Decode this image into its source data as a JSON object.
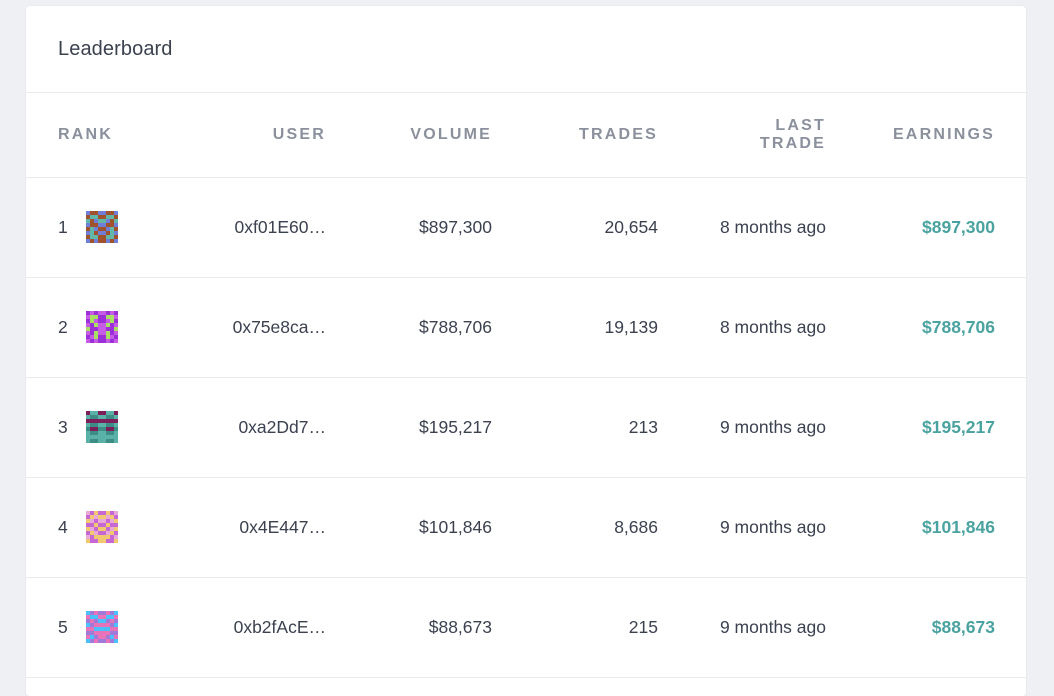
{
  "leaderboard": {
    "title": "Leaderboard",
    "columns": {
      "rank": "RANK",
      "user": "USER",
      "volume": "VOLUME",
      "trades": "TRADES",
      "last_trade": "LAST TRADE",
      "earnings": "EARNINGS"
    },
    "rows": [
      {
        "rank": "1",
        "user": "0xf01E60…",
        "volume": "$897,300",
        "trades": "20,654",
        "last_trade": "8 months ago",
        "earnings": "$897,300"
      },
      {
        "rank": "2",
        "user": "0x75e8ca…",
        "volume": "$788,706",
        "trades": "19,139",
        "last_trade": "8 months ago",
        "earnings": "$788,706"
      },
      {
        "rank": "3",
        "user": "0xa2Dd7…",
        "volume": "$195,217",
        "trades": "213",
        "last_trade": "9 months ago",
        "earnings": "$195,217"
      },
      {
        "rank": "4",
        "user": "0x4E447…",
        "volume": "$101,846",
        "trades": "8,686",
        "last_trade": "9 months ago",
        "earnings": "$101,846"
      },
      {
        "rank": "5",
        "user": "0xb2fAcE…",
        "volume": "$88,673",
        "trades": "215",
        "last_trade": "9 months ago",
        "earnings": "$88,673"
      }
    ]
  },
  "colors": {
    "earnings": "#4aa3a0",
    "header_text": "#8a909c",
    "body_text": "#3c4150",
    "background": "#eef0f4"
  },
  "avatars": [
    {
      "icon": "identicon-avatar",
      "fg": "#a0522d",
      "bg": "#6f7fd8",
      "spot": "#63b7a8"
    },
    {
      "icon": "identicon-avatar",
      "fg": "#9b30d9",
      "bg": "#c65be6",
      "spot": "#a8e063"
    },
    {
      "icon": "identicon-avatar",
      "fg": "#7b1f5b",
      "bg": "#5ab1a8",
      "spot": "#3d8c86"
    },
    {
      "icon": "identicon-avatar",
      "fg": "#c767d6",
      "bg": "#f0c870",
      "spot": "#e8a8d8"
    },
    {
      "icon": "identicon-avatar",
      "fg": "#4cc0ff",
      "bg": "#e873b8",
      "spot": "#a07ad8"
    }
  ]
}
